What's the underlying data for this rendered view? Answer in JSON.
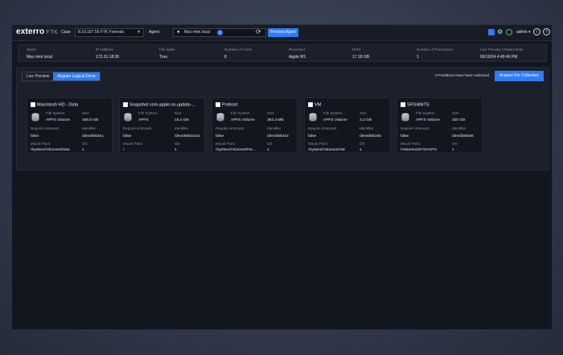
{
  "app": {
    "logo": "exterro",
    "logo_sub": "FTK"
  },
  "topbar": {
    "case_label": "Case",
    "case_value": "8.10.167.55 FTK Forensic",
    "agent_label": "Agent",
    "agent_value": "Mac-mini.local",
    "agent_badge": "1",
    "preview_button": "Preview Agent",
    "user": "admin"
  },
  "info": {
    "headers": [
      "Name",
      "IP Address",
      "File Index",
      "Number of Cores",
      "Processor",
      "RAM",
      "Number of Processors",
      "Live Preview Created Date"
    ],
    "values": [
      "Mac-mini.local",
      "173.31.18.30",
      "True",
      "8",
      "Apple M1",
      "17.18 GB",
      "1",
      "06/19/24 4:49:46 PM"
    ]
  },
  "tabs": [
    "Live Preview",
    "Acquire Logical Drive"
  ],
  "selection_text": "0 Partitions have been selected",
  "acquire_button": "Acquire For Collection",
  "field_labels": {
    "fs": "File System",
    "size": "Size",
    "unmount": "Require Unmount",
    "identifier": "Identifier",
    "mount": "Mount Point",
    "os": "OS"
  },
  "drives": [
    {
      "name": "Macintosh HD - Data",
      "fs": "APFS Volume",
      "size": "166.8 GB",
      "unmount": "false",
      "identifier": "/dev/disk3s1",
      "mount": "/System/Volumes/Data",
      "os": "1"
    },
    {
      "name": "Snapshot com.apple.os.update-...",
      "fs": "APFS",
      "size": "15.4 GB",
      "unmount": "false",
      "identifier": "/dev/disk3s1s1",
      "mount": "/",
      "os": "1"
    },
    {
      "name": "Preboot",
      "fs": "APFS Volume",
      "size": "384.3 MB",
      "unmount": "false",
      "identifier": "/dev/disk3s3",
      "mount": "/System/Volumes/Pre...",
      "os": "1"
    },
    {
      "name": "VM",
      "fs": "APFS Volume",
      "size": "3.2 GB",
      "unmount": "false",
      "identifier": "/dev/disk3s5",
      "mount": "/System/Volumes/VM",
      "os": "1"
    },
    {
      "name": "SFGIANTS",
      "fs": "APFS Volume",
      "size": "100 GB",
      "unmount": "false",
      "identifier": "/dev/disk5s6",
      "mount": "/Volumes/SFGIANTS",
      "os": "1"
    }
  ],
  "colors": {
    "accent": "#2f7cf6",
    "window": "#12161e",
    "panel": "#1b202a"
  }
}
